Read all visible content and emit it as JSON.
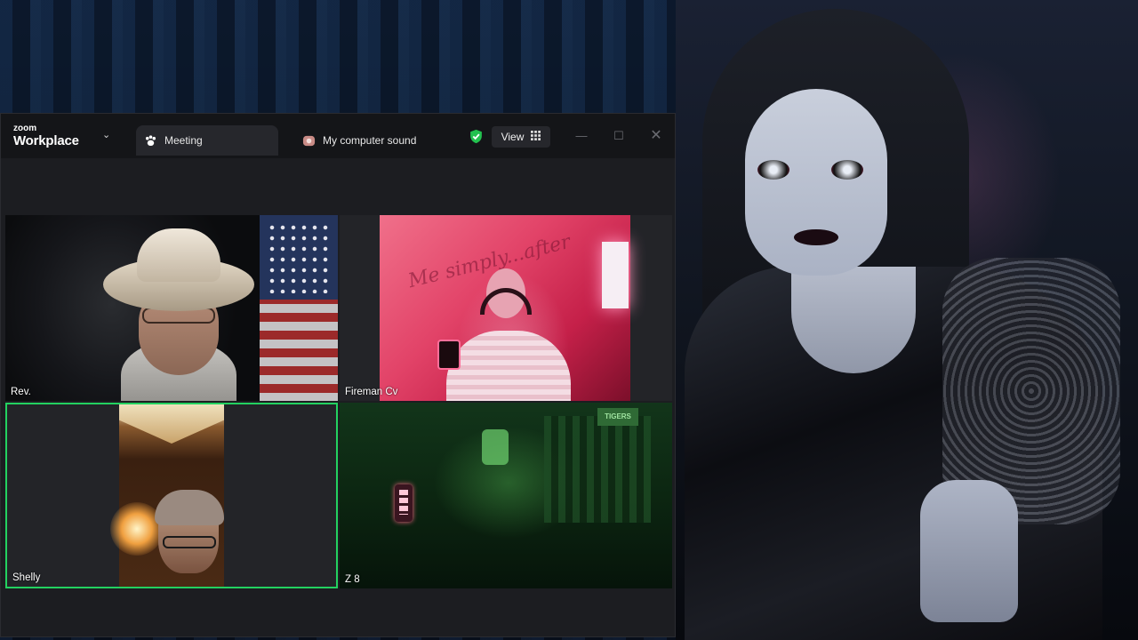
{
  "app": {
    "brand_small": "zoom",
    "brand_big": "Workplace"
  },
  "tabs": [
    {
      "label": "Meeting",
      "icon": "paw-icon",
      "active": true
    },
    {
      "label": "My computer sound",
      "icon": "speaker-app-icon",
      "active": false
    }
  ],
  "toolbar": {
    "view_label": "View",
    "view_icon": "grid-icon",
    "security_icon": "shield-check-icon",
    "accent_green": "#23d160"
  },
  "participants": [
    {
      "name": "Rev.",
      "speaking": false
    },
    {
      "name": "Fireman Cv",
      "speaking": false
    },
    {
      "name": "Shelly",
      "speaking": true
    },
    {
      "name": "Z 8",
      "speaking": false
    }
  ],
  "tile4_sign": "TIGERS",
  "tile2_writing": "Me simply...after"
}
